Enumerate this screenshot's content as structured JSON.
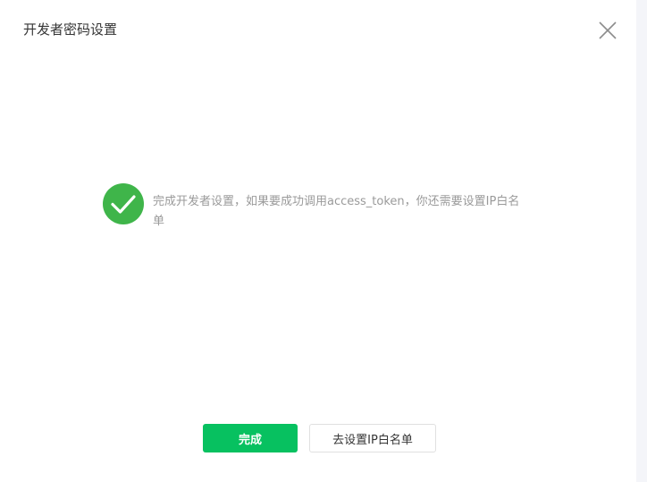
{
  "dialog": {
    "title": "开发者密码设置",
    "close_icon": "close-icon"
  },
  "result": {
    "icon": "check-circle-icon",
    "icon_color": "#3fb54a",
    "message": "完成开发者设置，如果要成功调用access_token，你还需要设置IP白名单"
  },
  "buttons": {
    "done_label": "完成",
    "done_color": "#07c160",
    "whitelist_label": "去设置IP白名单"
  }
}
